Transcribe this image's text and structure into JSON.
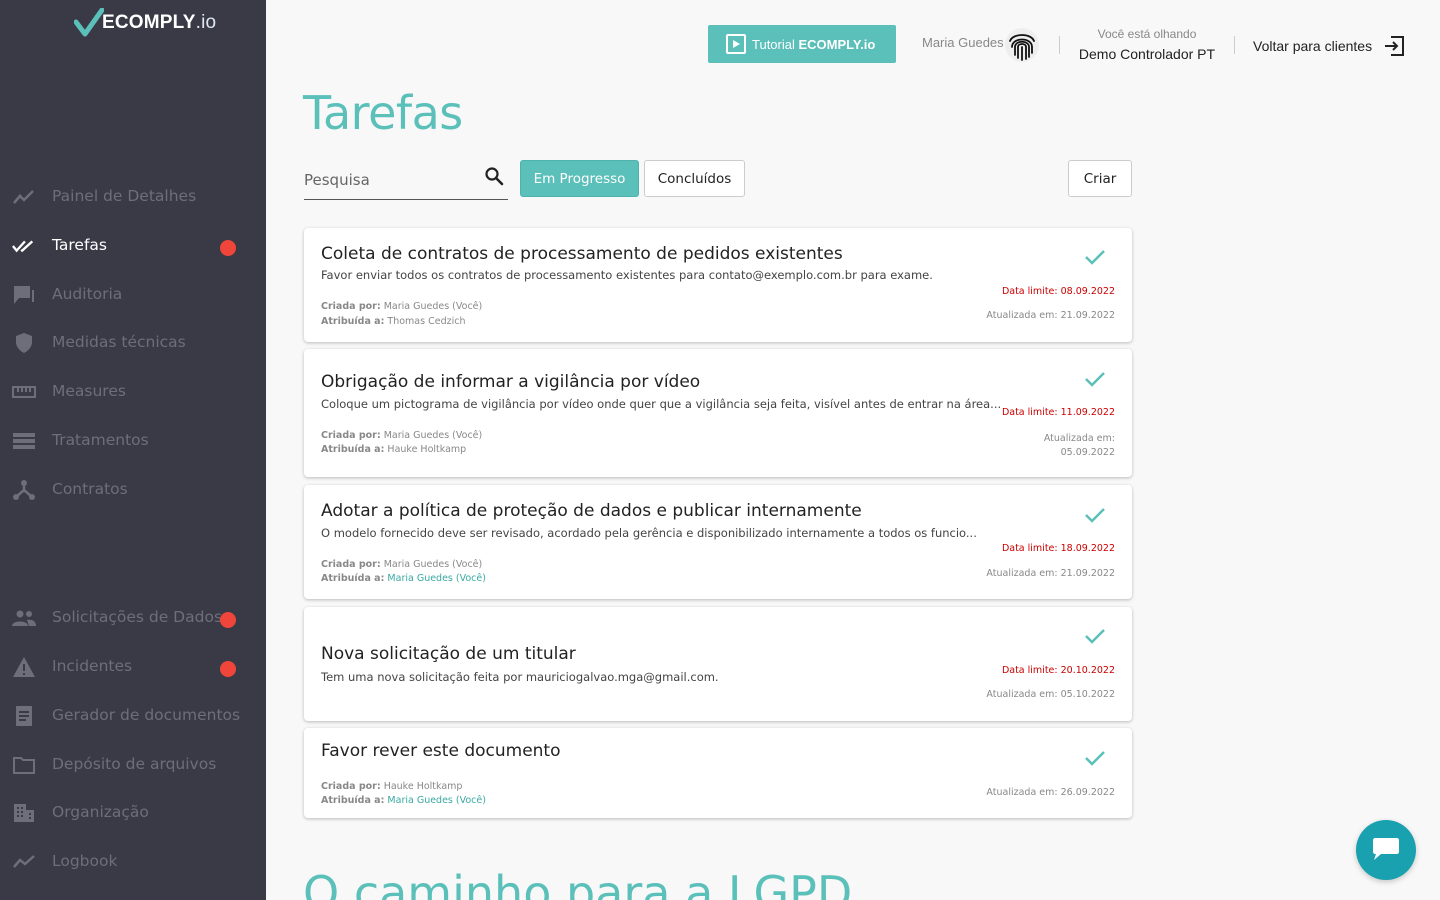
{
  "app": {
    "logo_text": "ECOMPLY",
    "logo_suffix": ".io"
  },
  "sidebar": {
    "items": [
      {
        "label": "Painel de Detalhes",
        "icon": "chart-line-icon",
        "active": false,
        "badge": false
      },
      {
        "label": "Tarefas",
        "icon": "double-check-icon",
        "active": true,
        "badge": true
      },
      {
        "label": "Auditoria",
        "icon": "chat-icon",
        "active": false,
        "badge": false
      },
      {
        "label": "Medidas técnicas",
        "icon": "shield-icon",
        "active": false,
        "badge": false
      },
      {
        "label": "Measures",
        "icon": "ruler-icon",
        "active": false,
        "badge": false
      },
      {
        "label": "Tratamentos",
        "icon": "list-icon",
        "active": false,
        "badge": false
      },
      {
        "label": "Contratos",
        "icon": "network-icon",
        "active": false,
        "badge": false
      },
      {
        "label": "Solicitações de Dados",
        "icon": "people-icon",
        "active": false,
        "badge": true
      },
      {
        "label": "Incidentes",
        "icon": "warning-icon",
        "active": false,
        "badge": true
      },
      {
        "label": "Gerador de documentos",
        "icon": "document-icon",
        "active": false,
        "badge": false
      },
      {
        "label": "Depósito de arquivos",
        "icon": "folder-icon",
        "active": false,
        "badge": false
      },
      {
        "label": "Organização",
        "icon": "building-icon",
        "active": false,
        "badge": false
      },
      {
        "label": "Logbook",
        "icon": "trend-icon",
        "active": false,
        "badge": false
      }
    ]
  },
  "header": {
    "tutorial_prefix": "Tutorial ",
    "tutorial_bold": "ECOMPLY.io",
    "user_name": "Maria Guedes",
    "viewing_label": "Você está olhando",
    "viewing_value": "Demo Controlador PT",
    "back_label": "Voltar para clientes"
  },
  "main": {
    "title": "Tarefas",
    "search_placeholder": "Pesquisa",
    "tab_in_progress": "Em Progresso",
    "tab_done": "Concluídos",
    "create_label": "Criar",
    "section_title": "O caminho para a LGPD"
  },
  "tasks": [
    {
      "title": "Coleta de contratos de processamento de pedidos existentes",
      "description": "Favor enviar todos os contratos de processamento existentes para contato@exemplo.com.br para exame.",
      "created_by_label": "Criada por:",
      "created_by": "Maria Guedes (Você)",
      "assigned_label": "Atribuída a:",
      "assigned_to": "Thomas Cedzich",
      "deadline": "Data limite: 08.09.2022",
      "updated": "Atualizada em: 21.09.2022"
    },
    {
      "title": "Obrigação de informar a vigilância por vídeo",
      "description": "Coloque um pictograma de vigilância por vídeo onde quer que a vigilância seja feita, visível antes de entrar na área...",
      "created_by_label": "Criada por:",
      "created_by": "Maria Guedes (Você)",
      "assigned_label": "Atribuída a:",
      "assigned_to": "Hauke Holtkamp",
      "deadline": "Data limite: 11.09.2022",
      "updated_line1": "Atualizada em:",
      "updated_line2": "05.09.2022"
    },
    {
      "title": "Adotar a política de proteção de dados e publicar internamente",
      "description": "O modelo fornecido deve ser revisado, acordado pela gerência e disponibilizado internamente a todos os funcio...",
      "created_by_label": "Criada por:",
      "created_by": "Maria Guedes (Você)",
      "assigned_label": "Atribuída a:",
      "assigned_to": "Maria Guedes (Você)",
      "deadline": "Data limite: 18.09.2022",
      "updated": "Atualizada em: 21.09.2022"
    },
    {
      "title": "Nova solicitação de um titular",
      "description": "Tem uma nova solicitação feita por mauriciogalvao.mga@gmail.com.",
      "deadline": "Data limite: 20.10.2022",
      "updated": "Atualizada em: 05.10.2022"
    },
    {
      "title": "Favor rever este documento",
      "created_by_label": "Criada por:",
      "created_by": "Hauke Holtkamp",
      "assigned_label": "Atribuída a:",
      "assigned_to": "Maria Guedes (Você)",
      "updated": "Atualizada em: 26.09.2022"
    }
  ],
  "colors": {
    "sidebar_bg": "#3a3a46",
    "accent": "#5bc0b9",
    "badge": "#f0453a",
    "deadline": "#cc0000",
    "chat": "#1aa1b0"
  }
}
